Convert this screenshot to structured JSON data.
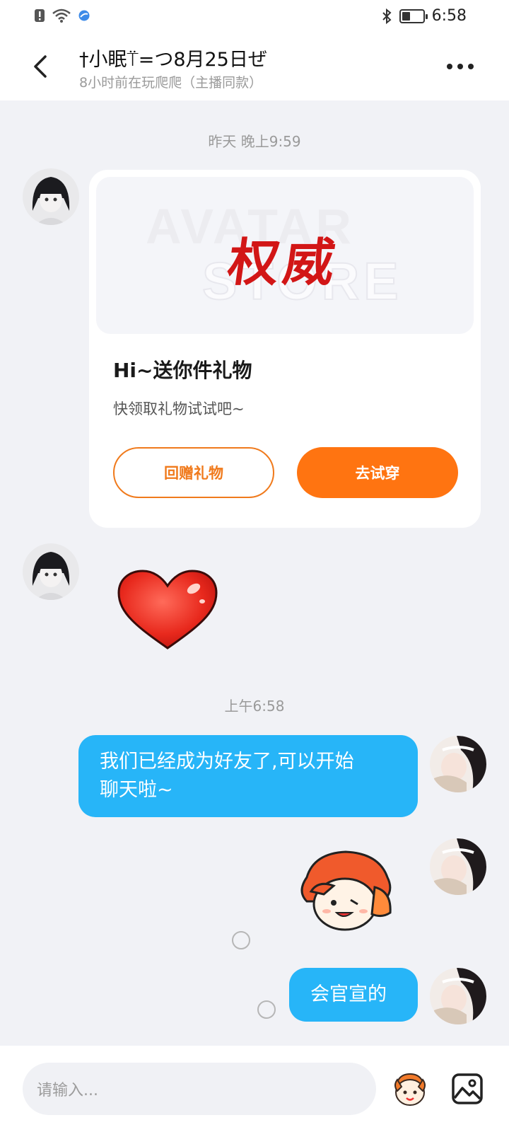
{
  "status_bar": {
    "time": "6:58"
  },
  "header": {
    "title": "†小眠⍡=つ8月25日ぜ",
    "subtitle": "8小时前在玩爬爬（主播同款）"
  },
  "messages": {
    "timestamp_1": "昨天 晚上9:59",
    "timestamp_2": "上午6:58",
    "gift_card": {
      "banner_text": "权威",
      "watermark_top": "AVATAR",
      "watermark_bottom": "STORE",
      "title": "Hi~送你件礼物",
      "description": "快领取礼物试试吧~",
      "return_gift_label": "回赠礼物",
      "try_on_label": "去试穿"
    },
    "bubble_1_line_1": "我们已经成为好友了,可以开始",
    "bubble_1_line_2": "聊天啦~",
    "bubble_2": "会官宣的"
  },
  "input_bar": {
    "placeholder": "请输入..."
  },
  "colors": {
    "accent_orange": "#ff7411",
    "bubble_blue": "#27b5f8",
    "background": "#f1f2f6"
  },
  "icons": [
    "back-arrow-icon",
    "more-dots-icon",
    "heart-sticker",
    "emoji-icon",
    "image-icon",
    "bluetooth-icon",
    "wifi-icon",
    "battery-icon"
  ]
}
